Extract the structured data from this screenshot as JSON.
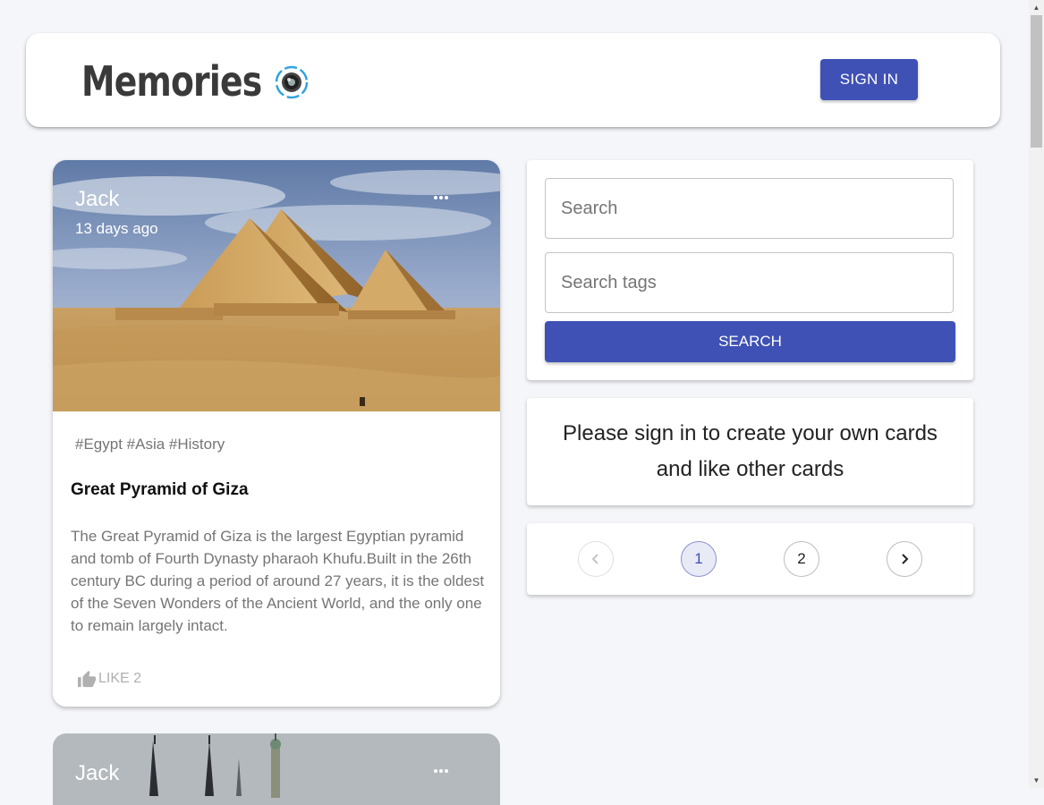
{
  "app": {
    "title": "Memories",
    "signin_label": "SIGN IN"
  },
  "posts": [
    {
      "author": "Jack",
      "time": "13 days ago",
      "tags": "#Egypt #Asia #History",
      "title": "Great Pyramid of Giza",
      "body": "The Great Pyramid of Giza is the largest Egyptian pyramid and tomb of Fourth Dynasty pharaoh Khufu.Built in the 26th century BC during a period of around 27 years, it is the oldest of the Seven Wonders of the Ancient World, and the only one to remain largely intact.",
      "like_label": "LIKE 2"
    },
    {
      "author": "Jack"
    }
  ],
  "search": {
    "placeholder": "Search",
    "tags_placeholder": "Search tags",
    "button_label": "SEARCH"
  },
  "notice": {
    "line1": "Please sign in to create your own cards",
    "line2": "and like other cards"
  },
  "pagination": {
    "pages": [
      "1",
      "2"
    ],
    "current": "1"
  },
  "colors": {
    "primary": "#3f51b5",
    "background": "#f5f6fa"
  }
}
